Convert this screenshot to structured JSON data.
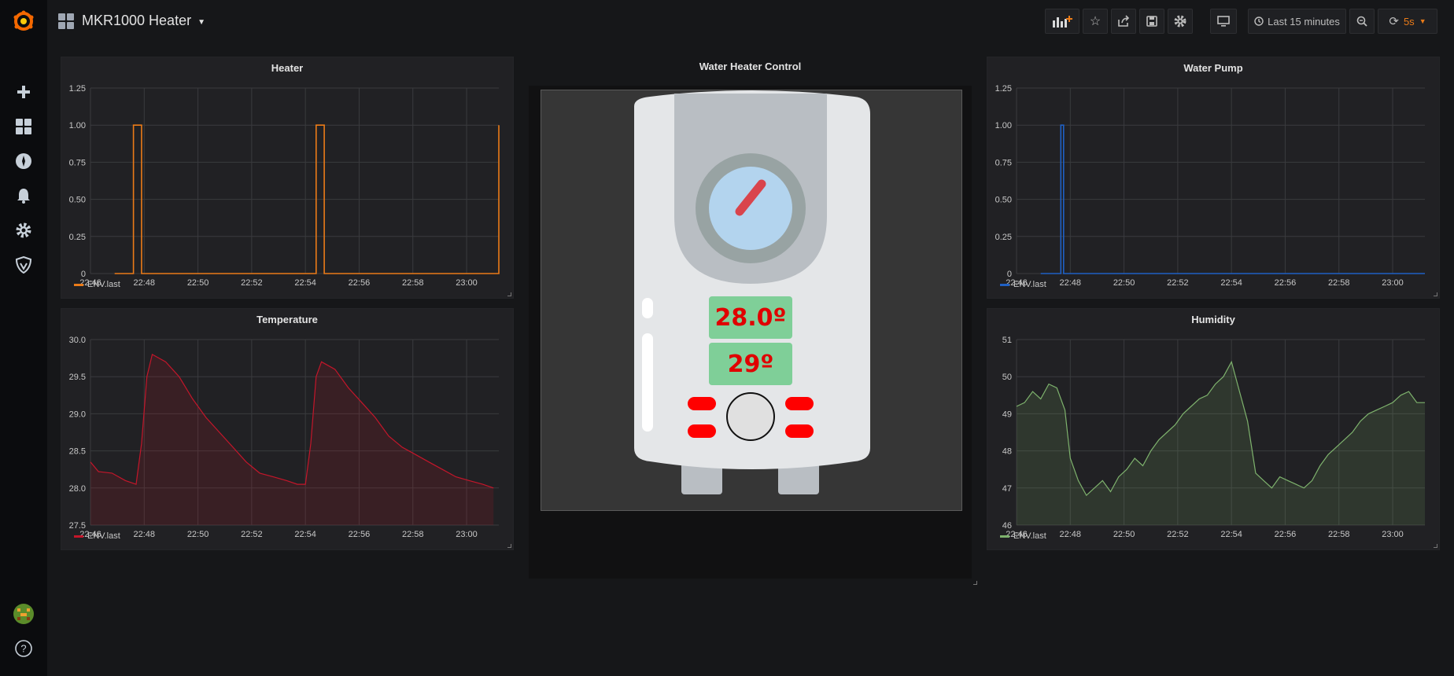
{
  "dashboard": {
    "title": "MKR1000 Heater"
  },
  "toolbar": {
    "time_range": "Last 15 minutes",
    "refresh": "5s"
  },
  "panels": {
    "heater": {
      "title": "Heater",
      "legend": "ENV.last",
      "color": "#eb7b18"
    },
    "pump": {
      "title": "Water Pump",
      "legend": "ENV.last",
      "color": "#1f60c4"
    },
    "temperature": {
      "title": "Temperature",
      "legend": "ENV.last",
      "color": "#c4162a"
    },
    "humidity": {
      "title": "Humidity",
      "legend": "ENV.last",
      "color": "#7eb26d"
    },
    "control": {
      "title": "Water Heater Control",
      "current_temp": "28.0º",
      "set_temp": "29º"
    }
  },
  "chart_data": [
    {
      "type": "line",
      "title": "Heater",
      "x_ticks": [
        "22:46",
        "22:48",
        "22:50",
        "22:52",
        "22:54",
        "22:56",
        "22:58",
        "23:00"
      ],
      "y_ticks": [
        "0",
        "0.25",
        "0.50",
        "0.75",
        "1.00",
        "1.25"
      ],
      "ylim": [
        0,
        1.25
      ],
      "series": [
        {
          "name": "ENV.last",
          "points": [
            [
              0.9,
              0
            ],
            [
              1.6,
              0
            ],
            [
              1.6,
              1
            ],
            [
              1.9,
              1
            ],
            [
              1.9,
              0
            ],
            [
              8.4,
              0
            ],
            [
              8.4,
              1
            ],
            [
              8.7,
              1
            ],
            [
              8.7,
              0
            ],
            [
              15.2,
              0
            ],
            [
              15.2,
              1
            ]
          ]
        }
      ]
    },
    {
      "type": "line",
      "title": "Water Pump",
      "x_ticks": [
        "22:46",
        "22:48",
        "22:50",
        "22:52",
        "22:54",
        "22:56",
        "22:58",
        "23:00"
      ],
      "y_ticks": [
        "0",
        "0.25",
        "0.50",
        "0.75",
        "1.00",
        "1.25"
      ],
      "ylim": [
        0,
        1.25
      ],
      "series": [
        {
          "name": "ENV.last",
          "points": [
            [
              0.9,
              0
            ],
            [
              1.65,
              0
            ],
            [
              1.65,
              1
            ],
            [
              1.75,
              1
            ],
            [
              1.75,
              0
            ],
            [
              15.2,
              0
            ]
          ]
        }
      ]
    },
    {
      "type": "area",
      "title": "Temperature",
      "x_ticks": [
        "22:46",
        "22:48",
        "22:50",
        "22:52",
        "22:54",
        "22:56",
        "22:58",
        "23:00"
      ],
      "y_ticks": [
        "27.5",
        "28.0",
        "28.5",
        "29.0",
        "29.5",
        "30.0"
      ],
      "ylim": [
        27.5,
        30.0
      ],
      "series": [
        {
          "name": "ENV.last",
          "points": [
            [
              0,
              28.35
            ],
            [
              0.3,
              28.22
            ],
            [
              0.8,
              28.2
            ],
            [
              1.3,
              28.1
            ],
            [
              1.7,
              28.05
            ],
            [
              1.9,
              28.6
            ],
            [
              2.1,
              29.5
            ],
            [
              2.3,
              29.8
            ],
            [
              2.8,
              29.7
            ],
            [
              3.3,
              29.5
            ],
            [
              3.8,
              29.2
            ],
            [
              4.3,
              28.95
            ],
            [
              4.8,
              28.75
            ],
            [
              5.3,
              28.55
            ],
            [
              5.8,
              28.35
            ],
            [
              6.3,
              28.2
            ],
            [
              6.8,
              28.15
            ],
            [
              7.3,
              28.1
            ],
            [
              7.7,
              28.05
            ],
            [
              8.0,
              28.05
            ],
            [
              8.2,
              28.6
            ],
            [
              8.4,
              29.5
            ],
            [
              8.6,
              29.7
            ],
            [
              9.1,
              29.6
            ],
            [
              9.6,
              29.35
            ],
            [
              10.1,
              29.15
            ],
            [
              10.6,
              28.95
            ],
            [
              11.1,
              28.7
            ],
            [
              11.6,
              28.55
            ],
            [
              12.1,
              28.45
            ],
            [
              12.6,
              28.35
            ],
            [
              13.1,
              28.25
            ],
            [
              13.6,
              28.15
            ],
            [
              14.1,
              28.1
            ],
            [
              14.6,
              28.05
            ],
            [
              15.0,
              28.0
            ]
          ]
        }
      ]
    },
    {
      "type": "area",
      "title": "Humidity",
      "x_ticks": [
        "22:46",
        "22:48",
        "22:50",
        "22:52",
        "22:54",
        "22:56",
        "22:58",
        "23:00"
      ],
      "y_ticks": [
        "46",
        "47",
        "48",
        "49",
        "50",
        "51"
      ],
      "ylim": [
        46,
        51
      ],
      "series": [
        {
          "name": "ENV.last",
          "points": [
            [
              0,
              49.2
            ],
            [
              0.3,
              49.3
            ],
            [
              0.6,
              49.6
            ],
            [
              0.9,
              49.4
            ],
            [
              1.2,
              49.8
            ],
            [
              1.5,
              49.7
            ],
            [
              1.8,
              49.1
            ],
            [
              2.0,
              47.8
            ],
            [
              2.3,
              47.2
            ],
            [
              2.6,
              46.8
            ],
            [
              2.9,
              47.0
            ],
            [
              3.2,
              47.2
            ],
            [
              3.5,
              46.9
            ],
            [
              3.8,
              47.3
            ],
            [
              4.1,
              47.5
            ],
            [
              4.4,
              47.8
            ],
            [
              4.7,
              47.6
            ],
            [
              5.0,
              48.0
            ],
            [
              5.3,
              48.3
            ],
            [
              5.6,
              48.5
            ],
            [
              5.9,
              48.7
            ],
            [
              6.2,
              49.0
            ],
            [
              6.5,
              49.2
            ],
            [
              6.8,
              49.4
            ],
            [
              7.1,
              49.5
            ],
            [
              7.4,
              49.8
            ],
            [
              7.7,
              50.0
            ],
            [
              8.0,
              50.4
            ],
            [
              8.3,
              49.6
            ],
            [
              8.6,
              48.8
            ],
            [
              8.9,
              47.4
            ],
            [
              9.2,
              47.2
            ],
            [
              9.5,
              47.0
            ],
            [
              9.8,
              47.3
            ],
            [
              10.1,
              47.2
            ],
            [
              10.4,
              47.1
            ],
            [
              10.7,
              47.0
            ],
            [
              11.0,
              47.2
            ],
            [
              11.3,
              47.6
            ],
            [
              11.6,
              47.9
            ],
            [
              11.9,
              48.1
            ],
            [
              12.2,
              48.3
            ],
            [
              12.5,
              48.5
            ],
            [
              12.8,
              48.8
            ],
            [
              13.1,
              49.0
            ],
            [
              13.4,
              49.1
            ],
            [
              13.7,
              49.2
            ],
            [
              14.0,
              49.3
            ],
            [
              14.3,
              49.5
            ],
            [
              14.6,
              49.6
            ],
            [
              14.9,
              49.3
            ],
            [
              15.2,
              49.3
            ]
          ]
        }
      ]
    }
  ]
}
